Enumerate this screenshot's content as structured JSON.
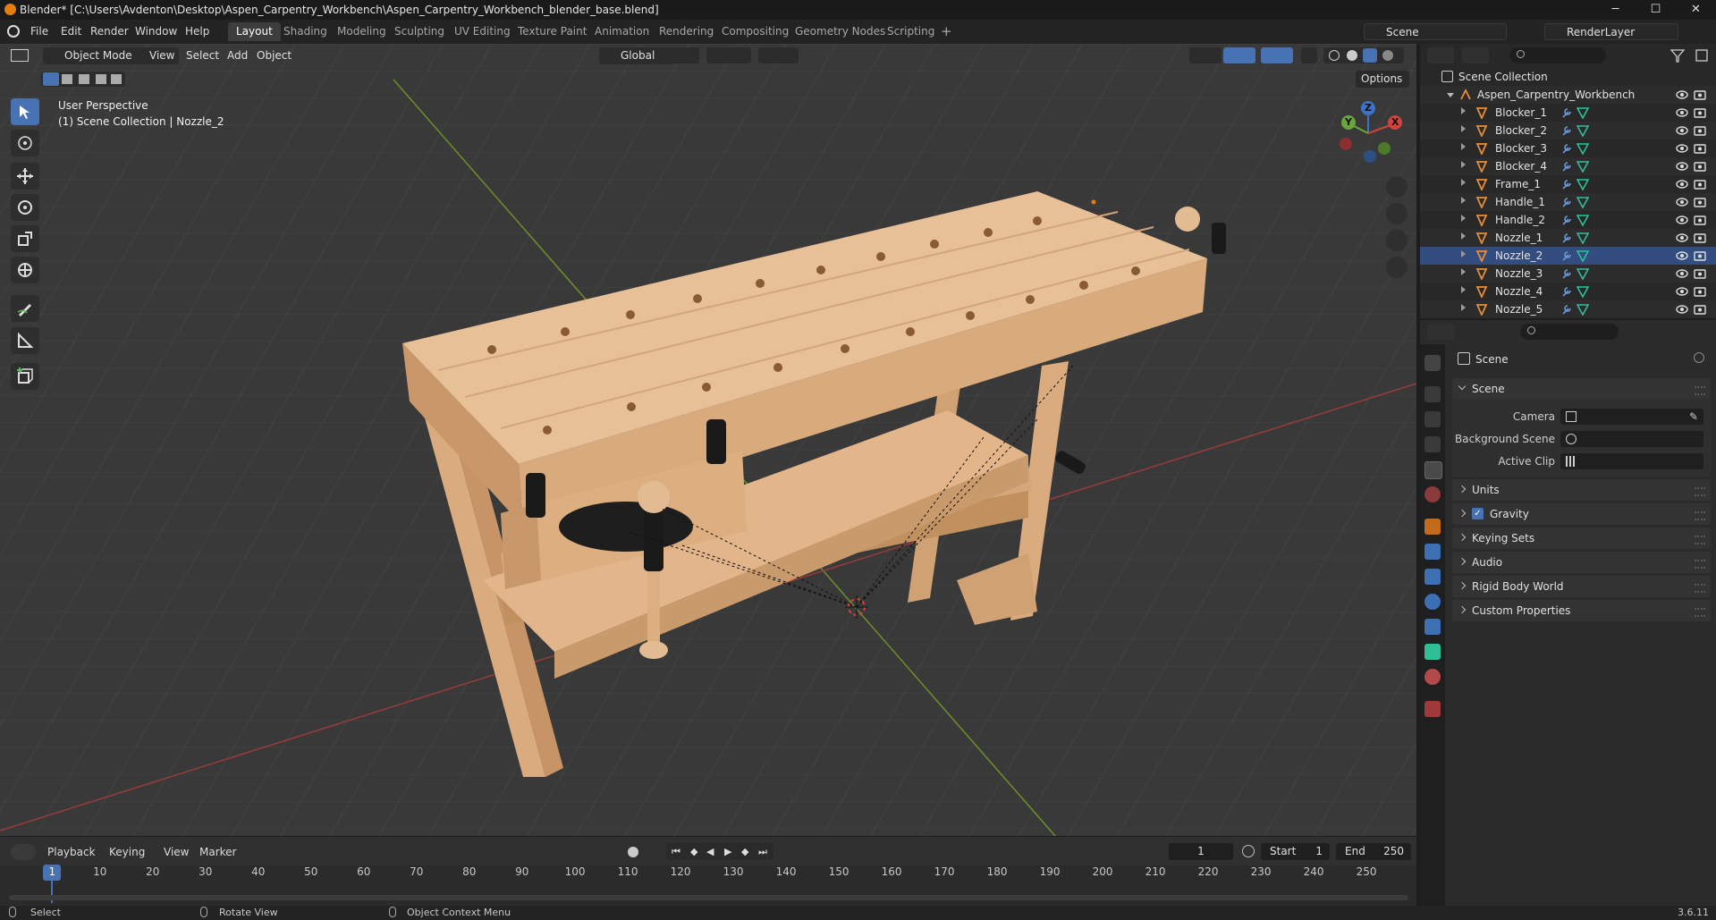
{
  "window": {
    "title": "Blender* [C:\\Users\\Avdenton\\Desktop\\Aspen_Carpentry_Workbench\\Aspen_Carpentry_Workbench_blender_base.blend]",
    "minimize": "─",
    "maximize": "☐",
    "close": "✕"
  },
  "menu": [
    "File",
    "Edit",
    "Render",
    "Window",
    "Help"
  ],
  "workspaces": [
    "Layout",
    "Shading",
    "Modeling",
    "Sculpting",
    "UV Editing",
    "Texture Paint",
    "Animation",
    "Rendering",
    "Compositing",
    "Geometry Nodes",
    "Scripting"
  ],
  "workspace_add": "+",
  "scene_field": "Scene",
  "view_layer_field": "RenderLayer",
  "viewport": {
    "mode": "Object Mode",
    "menus": [
      "View",
      "Select",
      "Add",
      "Object"
    ],
    "orientation": "Global",
    "options": "Options",
    "info_line1": "User Perspective",
    "info_line2": "(1) Scene Collection | Nozzle_2",
    "gizmo_x": "X",
    "gizmo_y": "Y",
    "gizmo_z": "Z"
  },
  "outliner": {
    "root": "Scene Collection",
    "collection": "Aspen_Carpentry_Workbench",
    "objects": [
      "Blocker_1",
      "Blocker_2",
      "Blocker_3",
      "Blocker_4",
      "Frame_1",
      "Handle_1",
      "Handle_2",
      "Nozzle_1",
      "Nozzle_2",
      "Nozzle_3",
      "Nozzle_4",
      "Nozzle_5"
    ]
  },
  "properties": {
    "context": "Scene",
    "panel_scene": "Scene",
    "camera_label": "Camera",
    "bg_scene_label": "Background Scene",
    "active_clip_label": "Active Clip",
    "panels": [
      "Units",
      "Gravity",
      "Keying Sets",
      "Audio",
      "Rigid Body World",
      "Custom Properties"
    ],
    "gravity_checked": true
  },
  "timeline": {
    "menus": [
      "Playback",
      "Keying",
      "View",
      "Marker"
    ],
    "current_frame": "1",
    "start_label": "Start",
    "start_value": "1",
    "end_label": "End",
    "end_value": "250",
    "ticks": [
      "1",
      "10",
      "20",
      "30",
      "40",
      "50",
      "60",
      "70",
      "80",
      "90",
      "100",
      "110",
      "120",
      "130",
      "140",
      "150",
      "160",
      "170",
      "180",
      "190",
      "200",
      "210",
      "220",
      "230",
      "240",
      "250"
    ]
  },
  "statusbar": {
    "select": "Select",
    "rotate": "Rotate View",
    "context_menu": "Object Context Menu",
    "version": "3.6.11"
  },
  "colors": {
    "accent": "#4772b3",
    "wood": "#e4b98f",
    "mesh_icon": "#e88d3a",
    "data_icon": "#2ebf98"
  }
}
